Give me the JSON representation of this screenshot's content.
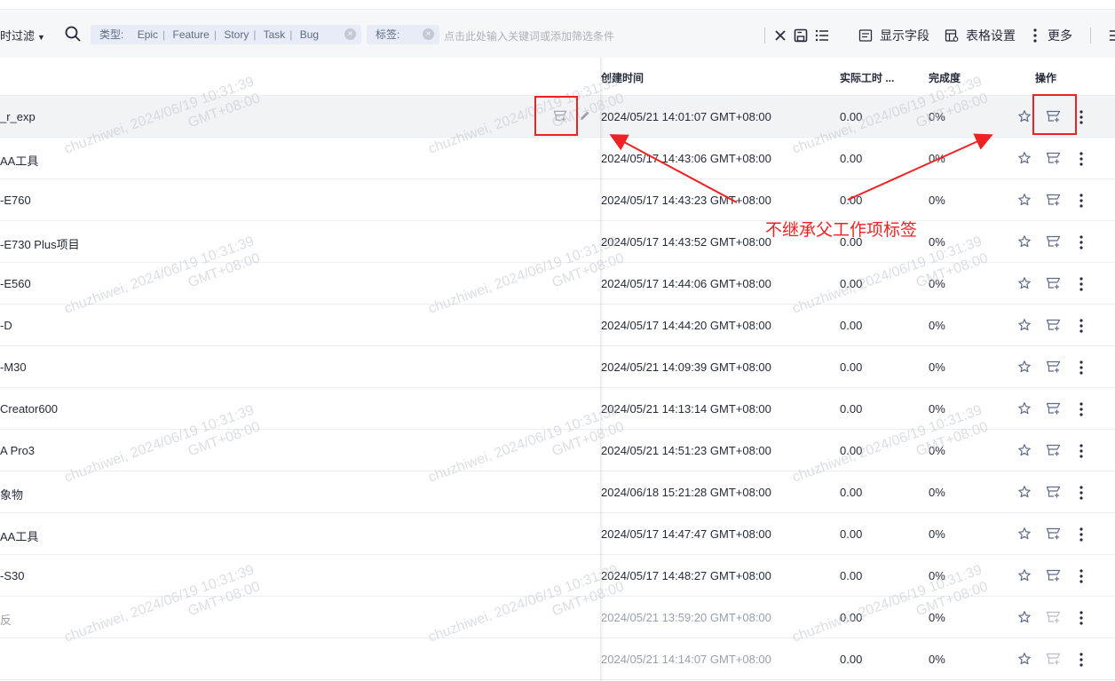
{
  "toolbar": {
    "filter_label": "时过滤",
    "chip_type": {
      "label": "类型:",
      "values": [
        "Epic",
        "Feature",
        "Story",
        "Task",
        "Bug"
      ]
    },
    "chip_tag": {
      "label": "标签:"
    },
    "search_placeholder": "点击此处输入关键词或添加筛选条件",
    "show_fields_label": "显示字段",
    "table_settings_label": "表格设置",
    "more_label": "更多"
  },
  "columns": {
    "created": "创建时间",
    "actual_hours": "实际工时 ...",
    "progress": "完成度",
    "actions": "操作"
  },
  "rows": [
    {
      "name": "_r_exp",
      "created": "2024/05/21 14:01:07 GMT+08:00",
      "hours": "0.00",
      "progress": "0%"
    },
    {
      "name": "AA工具",
      "created": "2024/05/17 14:43:06 GMT+08:00",
      "hours": "0.00",
      "progress": "0%"
    },
    {
      "name": "-E760",
      "created": "2024/05/17 14:43:23 GMT+08:00",
      "hours": "0.00",
      "progress": "0%"
    },
    {
      "name": "-E730 Plus项目",
      "created": "2024/05/17 14:43:52 GMT+08:00",
      "hours": "0.00",
      "progress": "0%"
    },
    {
      "name": "-E560",
      "created": "2024/05/17 14:44:06 GMT+08:00",
      "hours": "0.00",
      "progress": "0%"
    },
    {
      "name": "-D",
      "created": "2024/05/17 14:44:20 GMT+08:00",
      "hours": "0.00",
      "progress": "0%"
    },
    {
      "name": "-M30",
      "created": "2024/05/21 14:09:39 GMT+08:00",
      "hours": "0.00",
      "progress": "0%"
    },
    {
      "name": "Creator600",
      "created": "2024/05/21 14:13:14 GMT+08:00",
      "hours": "0.00",
      "progress": "0%"
    },
    {
      "name": " A Pro3",
      "created": "2024/05/21 14:51:23 GMT+08:00",
      "hours": "0.00",
      "progress": "0%"
    },
    {
      "name": "象物",
      "created": "2024/06/18 15:21:28 GMT+08:00",
      "hours": "0.00",
      "progress": "0%"
    },
    {
      "name": "AA工具",
      "created": "2024/05/17 14:47:47 GMT+08:00",
      "hours": "0.00",
      "progress": "0%"
    },
    {
      "name": "-S30",
      "created": "2024/05/17 14:48:27 GMT+08:00",
      "hours": "0.00",
      "progress": "0%"
    },
    {
      "name": "反",
      "created": "2024/05/21 13:59:20 GMT+08:00",
      "hours": "0.00",
      "progress": "0%"
    },
    {
      "name": "",
      "created": "2024/05/21 14:14:07 GMT+08:00",
      "hours": "0.00",
      "progress": "0%"
    }
  ],
  "watermark": {
    "line1": "chuzhiwei, 2024/06/19 10:31:39",
    "line2": "GMT+08:00"
  },
  "annotation": {
    "text": "不继承父工作项标签",
    "color": "#ee2222"
  }
}
